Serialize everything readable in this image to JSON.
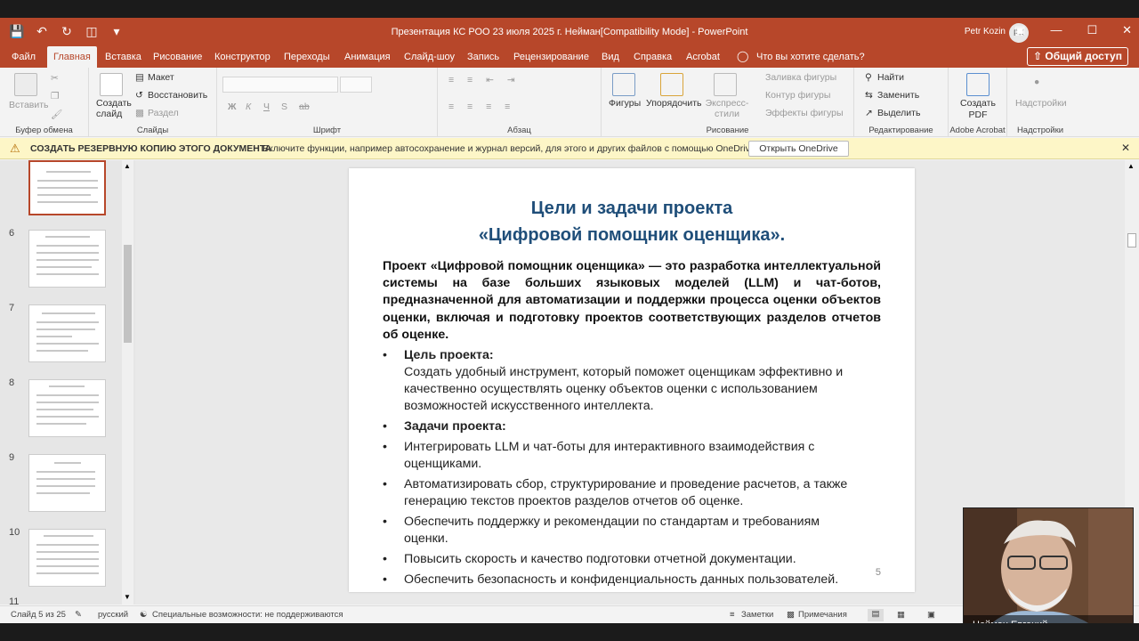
{
  "app": {
    "title": "Презентация КС РОО 23 июля 2025 г. Нейман[Compatibility Mode]  -  PowerPoint",
    "user": "Petr Kozin",
    "user_initials": "PK",
    "accent_color": "#b7472a"
  },
  "quick_access": [
    "save-icon",
    "undo-icon",
    "redo-icon",
    "present-icon",
    "customize-icon"
  ],
  "menu": {
    "tabs": [
      "Файл",
      "Главная",
      "Вставка",
      "Рисование",
      "Конструктор",
      "Переходы",
      "Анимация",
      "Слайд-шоу",
      "Запись",
      "Рецензирование",
      "Вид",
      "Справка",
      "Acrobat"
    ],
    "active_tab": "Главная",
    "tell_me": "Что вы хотите сделать?",
    "share": "Общий доступ"
  },
  "ribbon": {
    "clipboard": {
      "paste": "Вставить",
      "label": "Буфер обмена"
    },
    "slides": {
      "new_slide": "Создать слайд",
      "layout": "Макет",
      "reset": "Восстановить",
      "section": "Раздел",
      "label": "Слайды"
    },
    "font": {
      "label": "Шрифт",
      "buttons": [
        "Ж",
        "К",
        "Ч",
        "S",
        "ab"
      ]
    },
    "paragraph": {
      "label": "Абзац"
    },
    "drawing": {
      "shapes": "Фигуры",
      "arrange": "Упорядочить",
      "quick_styles": "Экспресс-стили",
      "fill": "Заливка фигуры",
      "outline": "Контур фигуры",
      "effects": "Эффекты фигуры",
      "label": "Рисование"
    },
    "editing": {
      "find": "Найти",
      "replace": "Заменить",
      "select": "Выделить",
      "label": "Редактирование"
    },
    "acrobat": {
      "create_pdf": "Создать PDF",
      "label": "Adobe Acrobat"
    },
    "addins": {
      "addins": "Надстройки",
      "label": "Надстройки"
    }
  },
  "infobar": {
    "title": "СОЗДАТЬ РЕЗЕРВНУЮ КОПИЮ ЭТОГО ДОКУМЕНТА",
    "text": "Включите функции, например автосохранение и журнал версий, для этого и других файлов с помощью OneDrive.",
    "button": "Открыть OneDrive"
  },
  "thumbnails": [
    "6",
    "7",
    "8",
    "9",
    "10",
    "11"
  ],
  "slide": {
    "title_line1": "Цели и задачи проекта",
    "title_line2": "«Цифровой помощник оценщика».",
    "intro": "Проект «Цифровой помощник оценщика» — это разработка интеллектуальной системы на базе больших языковых моделей (LLM) и чат-ботов, предназначенной для автоматизации и поддержки процесса оценки объектов оценки, включая и подготовку проектов соответствующих разделов отчетов об оценке.",
    "goal_heading": "Цель проекта:",
    "goal_text": "Создать удобный инструмент, который поможет оценщикам эффективно и качественно осуществлять оценку объектов оценки с использованием возможностей искусственного интеллекта.",
    "tasks_heading": "Задачи проекта:",
    "tasks": [
      "Интегрировать LLM и чат-боты для интерактивного взаимодействия с оценщиками.",
      "Автоматизировать сбор, структурирование и проведение расчетов, а также генерацию текстов проектов разделов отчетов об оценке.",
      "Обеспечить поддержку и рекомендации по стандартам и требованиям оценки.",
      "Повысить скорость и качество подготовки отчетной документации.",
      "Обеспечить безопасность и конфиденциальность данных пользователей."
    ],
    "page_number": "5"
  },
  "statusbar": {
    "slide_count": "Слайд 5 из 25",
    "language": "русский",
    "accessibility": "Специальные возможности: не поддерживаются",
    "notes": "Заметки",
    "comments": "Примечания"
  },
  "webcam": {
    "name": "Нейман Евгений"
  }
}
